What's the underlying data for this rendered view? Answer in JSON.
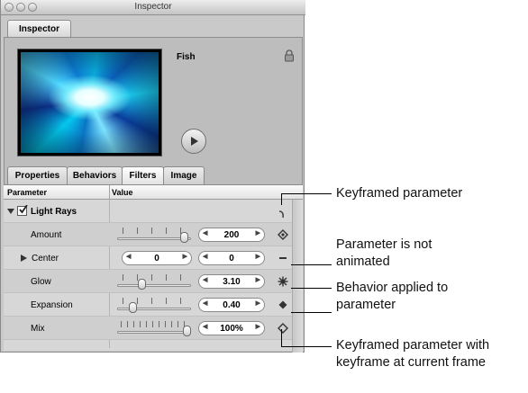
{
  "window": {
    "title": "Inspector",
    "top_tab": "Inspector"
  },
  "preview": {
    "object_name": "Fish"
  },
  "tabs": [
    {
      "label": "Properties",
      "active": false
    },
    {
      "label": "Behaviors",
      "active": false
    },
    {
      "label": "Filters",
      "active": true
    },
    {
      "label": "Image",
      "active": false
    }
  ],
  "table": {
    "col_parameter": "Parameter",
    "col_value": "Value",
    "filter_name": "Light Rays",
    "rows": [
      {
        "label": "Amount",
        "value": "200",
        "slider_level": 0.96,
        "status_icon": "keyframe-diamond"
      },
      {
        "label": "Center",
        "x": "0",
        "y": "0",
        "status_icon": "dash"
      },
      {
        "label": "Glow",
        "value": "3.10",
        "slider_level": 0.31,
        "status_icon": "behavior-gear"
      },
      {
        "label": "Expansion",
        "value": "0.40",
        "slider_level": 0.18,
        "status_icon": "keyframe-diamond-filled"
      },
      {
        "label": "Mix",
        "value": "100%",
        "slider_level": 1.0,
        "status_icon": "keyframe-current"
      }
    ]
  },
  "callouts": [
    "Keyframed parameter",
    "Parameter is not animated",
    "Behavior applied to parameter",
    "Keyframed parameter with keyframe at current frame"
  ],
  "colors": {
    "panel": "#c9c9c9",
    "table": "#d7d7d7",
    "field": "#ffffff"
  }
}
